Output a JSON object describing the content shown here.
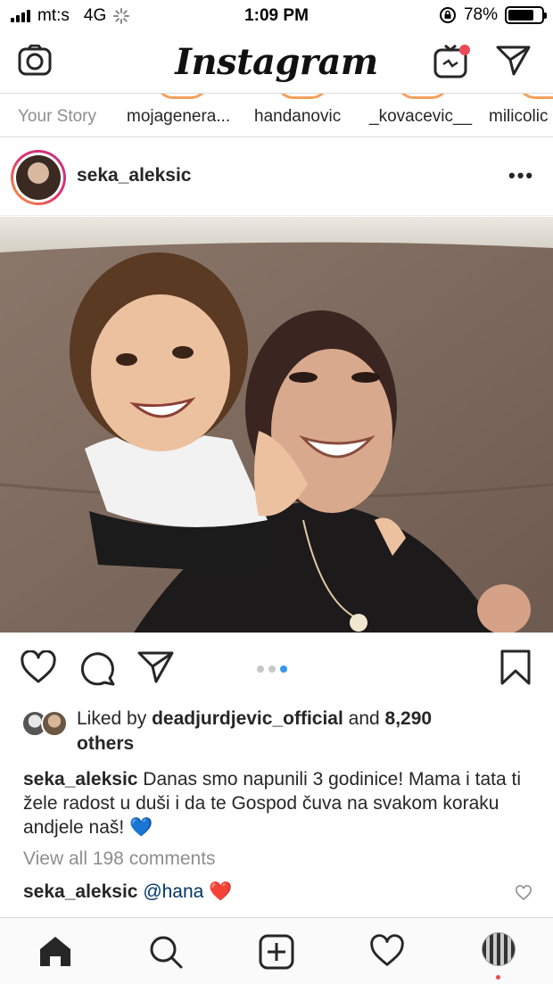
{
  "status_bar": {
    "carrier": "mt:s",
    "network": "4G",
    "time": "1:09 PM",
    "battery": "78%",
    "battery_level": 0.78
  },
  "header": {
    "logo": "Instagram",
    "icons": [
      "camera-icon",
      "igtv-icon",
      "direct-send-icon"
    ]
  },
  "stories": [
    {
      "label": "Your Story"
    },
    {
      "label": "mojagenera..."
    },
    {
      "label": "handanovic"
    },
    {
      "label": "_kovacevic__"
    },
    {
      "label": "milicolic"
    }
  ],
  "post": {
    "username": "seka_aleksic",
    "carousel": {
      "count": 3,
      "active": 3
    },
    "liked_by_prefix": "Liked by ",
    "liked_by_user": "deadjurdjevic_official",
    "liked_by_and": " and ",
    "liked_by_count": "8,290",
    "liked_by_suffix": "others",
    "caption_user": "seka_aleksic",
    "caption_text": " Danas smo napunili 3 godinice! Mama i tata ti žele radost u duši i da te Gospod čuva na svakom koraku andjele naš! 💙",
    "view_all_comments": "View all 198 comments",
    "comment_user": "seka_aleksic",
    "comment_mention": "@hana",
    "comment_emoji": "❤️"
  },
  "colors": {
    "link_blue": "#003569",
    "dot_active": "#3897f0",
    "notification_red": "#ed4956",
    "muted": "#8e8e8e"
  },
  "tab_bar": [
    "home-icon",
    "search-icon",
    "new-post-icon",
    "activity-heart-icon",
    "profile-avatar"
  ]
}
